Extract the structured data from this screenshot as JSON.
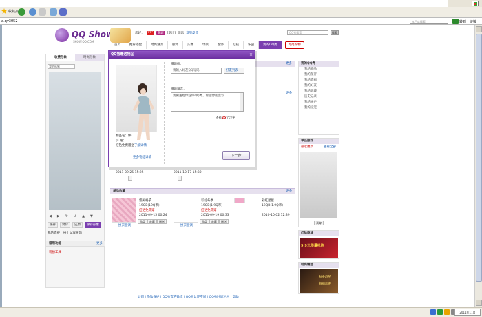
{
  "browser": {
    "favorites_label": "收藏夹",
    "address": "a.qv3052",
    "search_placeholder": "从百度搜索",
    "go_label": "转到",
    "links_label": "链接",
    "time": "2011年11月"
  },
  "brand": {
    "name": "QQ Show",
    "sub": "SHOW.QQ.COM"
  },
  "userbar": {
    "greeting": "您好：",
    "vip_badge": "VIP",
    "mall_badge": "商城",
    "logout": "[退出]",
    "msg": "消息",
    "feedback": "意见反馈",
    "search_placeholder": "QQ秀搜索",
    "search_btn": "搜索"
  },
  "nav": {
    "items": [
      "首页",
      "推荐搭配",
      "时尚潮流",
      "服饰",
      "头像",
      "场景",
      "配饰",
      "红钻",
      "乐园"
    ],
    "active": "我的QQ秀",
    "special": "时尚购物"
  },
  "left_panel": {
    "tabs": [
      "收费形象",
      "时尚形象"
    ],
    "name_value": "我的形象",
    "controls": [
      "◀",
      "▶",
      "↻",
      "↺",
      "▲",
      "▼"
    ],
    "buttons": [
      "保存",
      "试穿",
      "还原",
      "保存形象"
    ],
    "sub_links": [
      "我的衣柜",
      "换上试穿服饰"
    ],
    "section": "常用功能",
    "section_more": "更多",
    "tool": "装扮工具"
  },
  "center": {
    "section1_more": "更多",
    "dates": [
      "2011-09-25 15:25",
      "2011-10-17 15:30"
    ],
    "section2": "单品收藏",
    "section2_more": "更多",
    "items": [
      {
        "name": "悠闲格子",
        "price": "19QB(19Q币)",
        "badge": "红钻免费穿",
        "date": "2011-09-15 00:24"
      },
      {
        "name": "彩虹冬季",
        "price": "19QB(1.9Q币)",
        "badge": "红钻免费穿",
        "date": "2011-09-19 00:33"
      },
      {
        "name": "彩虹星星",
        "price": "19QB(1.9Q币)",
        "badge": "",
        "date": "2010-10-02 12:39"
      }
    ],
    "item_buttons": [
      "购买",
      "收藏",
      "赠送"
    ],
    "try_label": "换衣服试"
  },
  "right_panel": {
    "head1": "我的QQ秀",
    "list": [
      "我的物品",
      "我的保存",
      "我的衣橱",
      "我的好友",
      "我的收藏",
      "历史记录",
      "我的帐户",
      "我的设定"
    ],
    "head2": "单品推荐",
    "rec_title": "最近更新",
    "rec_more": "查看全部",
    "try_btn": "试穿",
    "head3": "红钻商城",
    "head4": "时尚精选",
    "ad1": "9.9元限量抢购",
    "ad2": "秋冬趋势",
    "ad3": "靓丽出击"
  },
  "footer": "公司 | 隐私保护 | QQ秀官方微博 | QQ秀认证空间 | QQ秀时尚达人 | 帮助",
  "dialog": {
    "title": "QQ秀赠送物品",
    "close": "×",
    "product_name_label": "物品名：",
    "product_name": "件",
    "product_price_label": "价  格：",
    "product_note": "红钻免费赠送",
    "product_note_link": "了解详情",
    "more_link": "更多物品详情",
    "recipient_label": "赠送给：",
    "recipient_placeholder": "请输入好友QQ号码",
    "friends_btn": "好友列表",
    "message_label": "赠送留言：",
    "message_value": "我要送给你这件QQ秀，希望你能喜欢",
    "counter_prefix": "还有",
    "counter_num": "25",
    "counter_suffix": "个汉字",
    "next_btn": "下一步"
  }
}
